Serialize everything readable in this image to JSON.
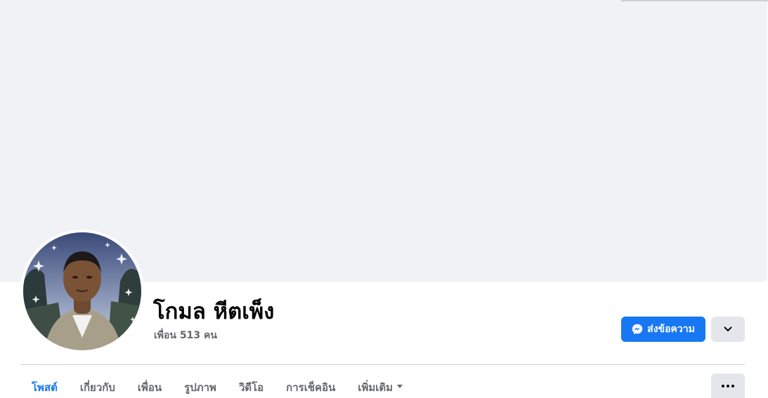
{
  "profile": {
    "name": "โกมล หีตเพ็ง",
    "friends_count": "เพื่อน 513 คน"
  },
  "actions": {
    "message_label": "ส่งข้อความ"
  },
  "tabs": [
    {
      "label": "โพสต์",
      "active": true
    },
    {
      "label": "เกี่ยวกับ",
      "active": false
    },
    {
      "label": "เพื่อน",
      "active": false
    },
    {
      "label": "รูปภาพ",
      "active": false
    },
    {
      "label": "วิดีโอ",
      "active": false
    },
    {
      "label": "การเช็คอิน",
      "active": false
    },
    {
      "label": "เพิ่มเติม",
      "active": false
    }
  ],
  "colors": {
    "accent": "#1877f2",
    "cover_bg": "#f0f2f5",
    "button_gray": "#e4e6eb",
    "secondary_text": "#65676b"
  },
  "icons": {
    "message": "messenger-icon",
    "dropdown": "chevron-down-icon",
    "more": "more-dots-icon",
    "tab_more": "caret-down-icon"
  }
}
